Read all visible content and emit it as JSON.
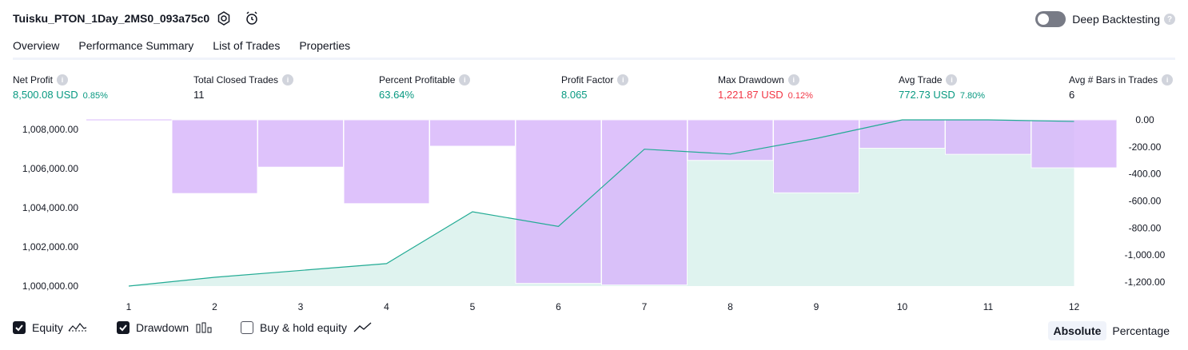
{
  "header": {
    "strategy_name": "Tuisku_PTON_1Day_2MS0_093a75c0",
    "settings_icon": "gear-icon",
    "replay_icon": "alarm-refresh-icon",
    "deep_backtesting_label": "Deep Backtesting",
    "deep_backtesting_enabled": false
  },
  "tabs": [
    {
      "label": "Overview",
      "active": true
    },
    {
      "label": "Performance Summary",
      "active": false
    },
    {
      "label": "List of Trades",
      "active": false
    },
    {
      "label": "Properties",
      "active": false
    }
  ],
  "metrics": [
    {
      "label": "Net Profit",
      "value": "8,500.08 USD",
      "pct": "0.85%",
      "tone": "pos"
    },
    {
      "label": "Total Closed Trades",
      "value": "11",
      "pct": "",
      "tone": "plain"
    },
    {
      "label": "Percent Profitable",
      "value": "63.64%",
      "pct": "",
      "tone": "pos"
    },
    {
      "label": "Profit Factor",
      "value": "8.065",
      "pct": "",
      "tone": "pos"
    },
    {
      "label": "Max Drawdown",
      "value": "1,221.87 USD",
      "pct": "0.12%",
      "tone": "neg"
    },
    {
      "label": "Avg Trade",
      "value": "772.73 USD",
      "pct": "7.80%",
      "tone": "pos"
    },
    {
      "label": "Avg # Bars in Trades",
      "value": "6",
      "pct": "",
      "tone": "plain"
    }
  ],
  "colors": {
    "equity_line": "#22ab94",
    "equity_fill": "#d4efe9",
    "drawdown_fill": "#d9b8fb",
    "positive": "#089981",
    "negative": "#f23645"
  },
  "chart_data": {
    "type": "line",
    "x": [
      1,
      2,
      3,
      4,
      5,
      6,
      7,
      8,
      9,
      10,
      11,
      12
    ],
    "series": [
      {
        "name": "Equity",
        "axis": "left",
        "values": [
          1000000,
          1000450,
          1000800,
          1001150,
          1003800,
          1003050,
          1007000,
          1006750,
          1007550,
          1008500,
          1008500,
          1008420
        ]
      },
      {
        "name": "Drawdown",
        "axis": "right",
        "type": "bar",
        "values": [
          0,
          -545,
          -350,
          -620,
          -195,
          -1210,
          -1222,
          -300,
          -540,
          -210,
          -255,
          -355
        ]
      }
    ],
    "left_axis": {
      "ticks": [
        "1,000,000.00",
        "1,002,000.00",
        "1,004,000.00",
        "1,006,000.00",
        "1,008,000.00"
      ],
      "ylim": [
        1000000,
        1008500
      ]
    },
    "right_axis": {
      "ticks": [
        "0.00",
        "-200.00",
        "-400.00",
        "-600.00",
        "-800.00",
        "-1,000.00",
        "-1,200.00"
      ],
      "ylim": [
        -1230,
        0
      ]
    }
  },
  "footer": {
    "equity_label": "Equity",
    "equity_checked": true,
    "drawdown_label": "Drawdown",
    "drawdown_checked": true,
    "buyhold_label": "Buy & hold equity",
    "buyhold_checked": false,
    "absolute_label": "Absolute",
    "percentage_label": "Percentage",
    "mode": "Absolute"
  }
}
